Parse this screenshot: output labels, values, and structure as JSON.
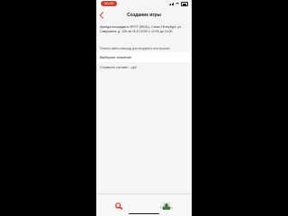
{
  "status_bar": {
    "time_label": "00:00"
  },
  "nav": {
    "title": "Создание игры",
    "back_icon": "chevron-left-icon"
  },
  "main": {
    "description": "Аренда площадки в SPOT (SKOL), Санкт-Петербург, ул. Савушкина, д. 126 на 15.10.2022 с 12:00 до 14:00",
    "hint": "Помочь найти команду для спарринга или игроков",
    "select": {
      "value": "Выберите значение"
    },
    "cost": "Стоимость составит - руб."
  },
  "tab_bar": {
    "items": [
      {
        "label": "Поиск",
        "icon": "search-icon",
        "active": true
      },
      {
        "label": "Профиль",
        "icon": "profile-avatar-icon",
        "active": false
      }
    ]
  },
  "colors": {
    "accent": "#d63b2f",
    "background": "#f5f5f5",
    "outer_background": "#000000"
  }
}
